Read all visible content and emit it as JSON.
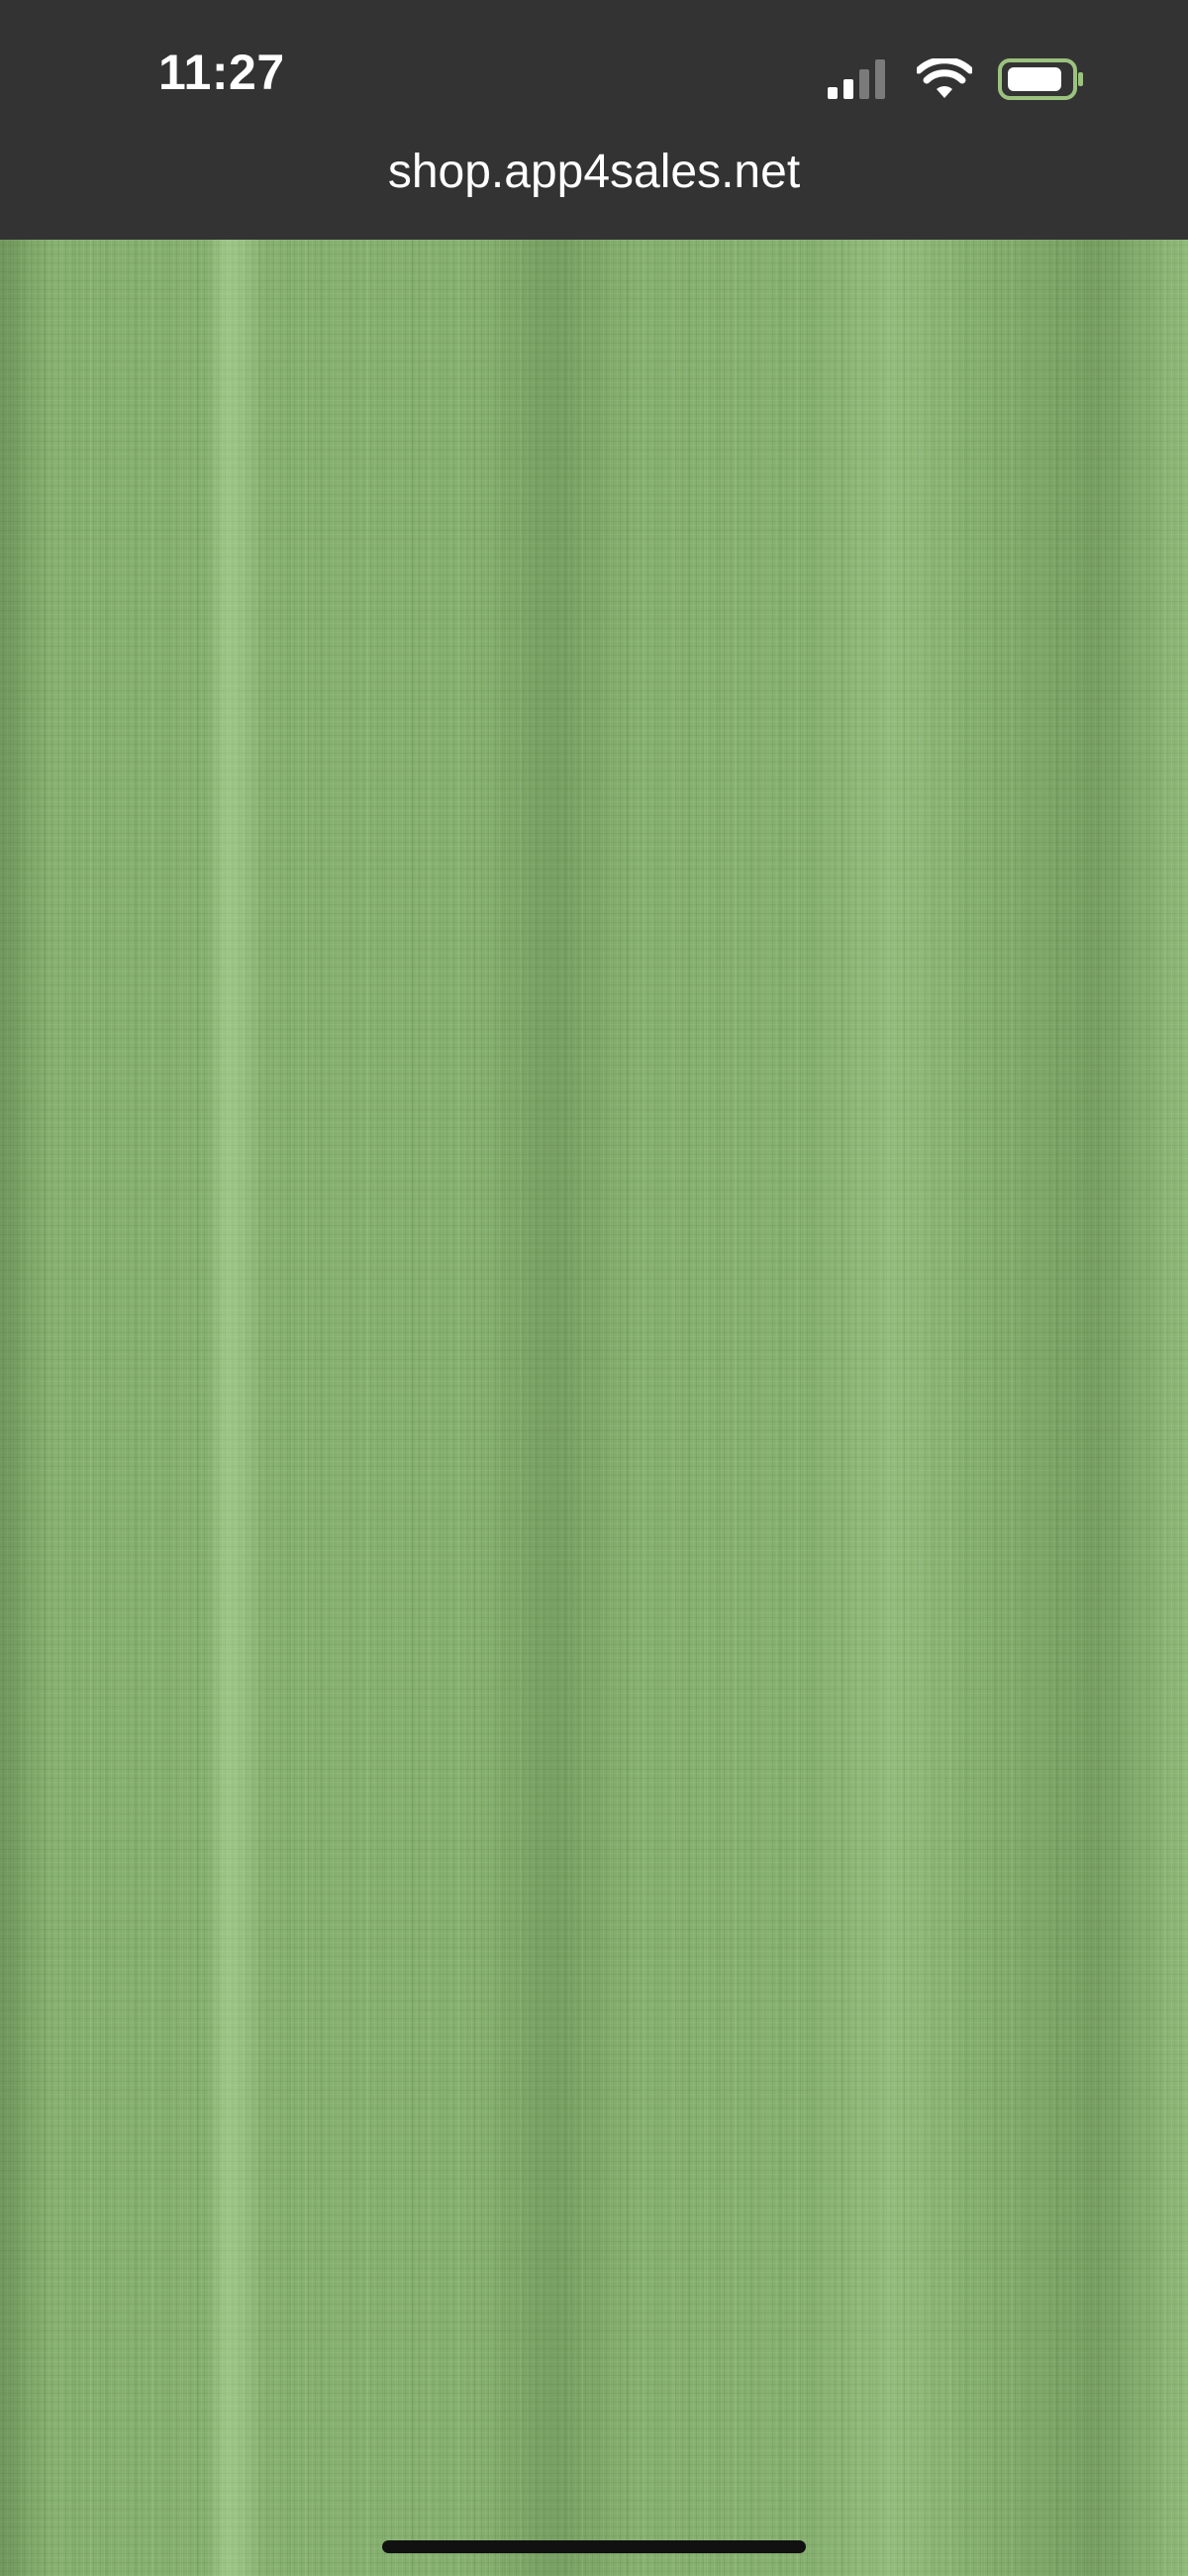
{
  "status_bar": {
    "time": "11:27",
    "icons": [
      "cellular-signal-icon",
      "wifi-icon",
      "battery-icon"
    ],
    "battery_outline_color": "#9bc27f"
  },
  "browser": {
    "url": "shop.app4sales.net"
  },
  "content": {
    "image_name": "green-fabric-texture",
    "dominant_color": "#86b06f"
  },
  "colors": {
    "chrome_background": "#333333",
    "text": "#ffffff"
  }
}
